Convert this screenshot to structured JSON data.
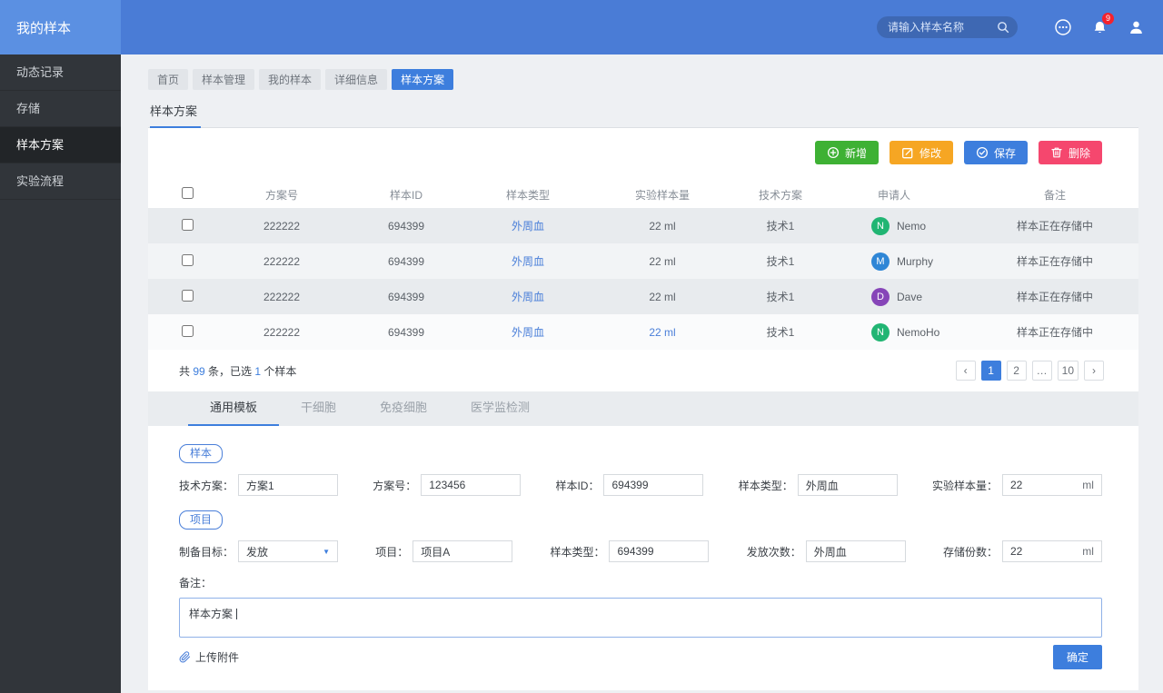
{
  "app": {
    "title": "我的样本"
  },
  "topbar": {
    "search_placeholder": "请输入样本名称",
    "notification_badge": "9"
  },
  "sidebar": {
    "items": [
      {
        "label": "动态记录"
      },
      {
        "label": "存储"
      },
      {
        "label": "样本方案"
      },
      {
        "label": "实验流程"
      }
    ],
    "active_index": 2
  },
  "breadcrumbs": {
    "items": [
      {
        "label": "首页"
      },
      {
        "label": "样本管理"
      },
      {
        "label": "我的样本"
      },
      {
        "label": "详细信息"
      },
      {
        "label": "样本方案"
      }
    ],
    "active_index": 4
  },
  "page": {
    "section_title": "样本方案"
  },
  "toolbar": {
    "add_label": "新增",
    "edit_label": "修改",
    "save_label": "保存",
    "delete_label": "删除"
  },
  "colors": {
    "topbar_blue": "#4a7cd6",
    "brand_blue": "#5b90e2",
    "accent_blue": "#3d7edd",
    "link_blue": "#4a7fd9",
    "add_green": "#3eb134",
    "edit_orange": "#f6a623",
    "delete_pink": "#f5476e",
    "badge_red": "#f5222d"
  },
  "table": {
    "headers": {
      "plan_no": "方案号",
      "sample_id": "样本ID",
      "sample_type": "样本类型",
      "sample_amount": "实验样本量",
      "tech_plan": "技术方案",
      "applicant": "申请人",
      "remark": "备注"
    },
    "rows": [
      {
        "plan_no": "222222",
        "sample_id": "694399",
        "sample_type": "外周血",
        "amount": "22 ml",
        "tech_plan": "技术1",
        "applicant": "Nemo",
        "avatar_letter": "N",
        "avatar_color": "#21b573",
        "remark": "样本正在存储中"
      },
      {
        "plan_no": "222222",
        "sample_id": "694399",
        "sample_type": "外周血",
        "amount": "22 ml",
        "tech_plan": "技术1",
        "applicant": "Murphy",
        "avatar_letter": "M",
        "avatar_color": "#2f86d6",
        "remark": "样本正在存储中"
      },
      {
        "plan_no": "222222",
        "sample_id": "694399",
        "sample_type": "外周血",
        "amount": "22 ml",
        "tech_plan": "技术1",
        "applicant": "Dave",
        "avatar_letter": "D",
        "avatar_color": "#8645b8",
        "remark": "样本正在存储中"
      },
      {
        "plan_no": "222222",
        "sample_id": "694399",
        "sample_type": "外周血",
        "amount": "22 ml",
        "tech_plan": "技术1",
        "applicant": "NemoHo",
        "avatar_letter": "N",
        "avatar_color": "#21b573",
        "remark": "样本正在存储中"
      }
    ],
    "summary": {
      "text_prefix": "共 ",
      "total": "99",
      "text_mid": " 条，已选 ",
      "selected": "1",
      "text_suffix": " 个样本"
    }
  },
  "pagination": {
    "prev": "‹",
    "pages": [
      "1",
      "2",
      "…",
      "10"
    ],
    "active_page": "1",
    "next": "›"
  },
  "form_tabs": {
    "items": [
      {
        "label": "通用模板"
      },
      {
        "label": "干细胞"
      },
      {
        "label": "免疫细胞"
      },
      {
        "label": "医学监检测"
      }
    ],
    "active_index": 0
  },
  "form": {
    "sample_section_badge": "样本",
    "project_section_badge": "项目",
    "row1": [
      {
        "label": "技术方案：",
        "value": "方案1"
      },
      {
        "label": "方案号：",
        "value": "123456"
      },
      {
        "label": "样本ID：",
        "value": "694399"
      },
      {
        "label": "样本类型：",
        "value": "外周血"
      },
      {
        "label": "实验样本量：",
        "value": "22",
        "unit": "ml"
      }
    ],
    "row2": [
      {
        "label": "制备目标：",
        "value": "发放"
      },
      {
        "label": "项目：",
        "value": "项目A"
      },
      {
        "label": "样本类型：",
        "value": "694399"
      },
      {
        "label": "发放次数：",
        "value": "外周血"
      },
      {
        "label": "存储份数：",
        "value": "22",
        "unit": "ml"
      }
    ],
    "remark_label": "备注：",
    "remark_value": "样本方案",
    "upload_label": "上传附件",
    "confirm_label": "确定"
  },
  "icons": {
    "caret_down": "▼"
  }
}
